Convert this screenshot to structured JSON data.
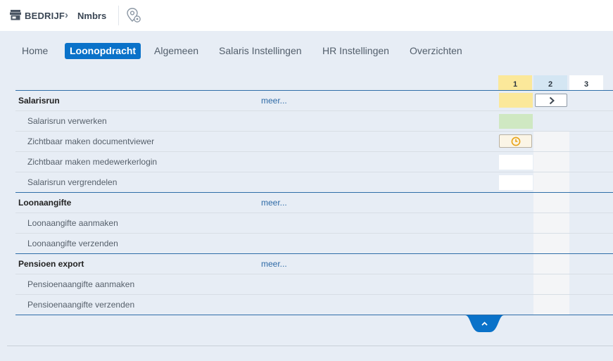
{
  "breadcrumb": {
    "company": "BEDRIJF",
    "separator": "›",
    "app": "Nmbrs",
    "company_icon": "store-icon",
    "location_icon": "location-settings-icon"
  },
  "tabs": [
    {
      "label": "Home",
      "active": false
    },
    {
      "label": "Loonopdracht",
      "active": true
    },
    {
      "label": "Algemeen",
      "active": false
    },
    {
      "label": "Salaris Instellingen",
      "active": false
    },
    {
      "label": "HR Instellingen",
      "active": false
    },
    {
      "label": "Overzichten",
      "active": false
    }
  ],
  "columns": [
    "1",
    "2",
    "3"
  ],
  "groups": [
    {
      "title": "Salarisrun",
      "more": "meer...",
      "rows": [
        "Salarisrun verwerken",
        "Zichtbaar maken documentviewer",
        "Zichtbaar maken medewerkerlogin",
        "Salarisrun vergrendelen"
      ]
    },
    {
      "title": "Loonaangifte",
      "more": "meer...",
      "rows": [
        "Loonaangifte aanmaken",
        "Loonaangifte verzenden"
      ]
    },
    {
      "title": "Pensioen export",
      "more": "meer...",
      "rows": [
        "Pensioenaangifte aanmaken",
        "Pensioenaangifte verzenden"
      ]
    }
  ],
  "colors": {
    "accent": "#0a72c9",
    "group_line": "#2f6ea8",
    "period_current": "#fbe89a",
    "period_next": "#d4e6f3",
    "status_done": "#cfe8c2",
    "status_pending_icon": "#e8a317"
  },
  "icons": {
    "next": "chevron-right-icon",
    "pending": "clock-icon",
    "collapse": "chevron-up-icon"
  }
}
